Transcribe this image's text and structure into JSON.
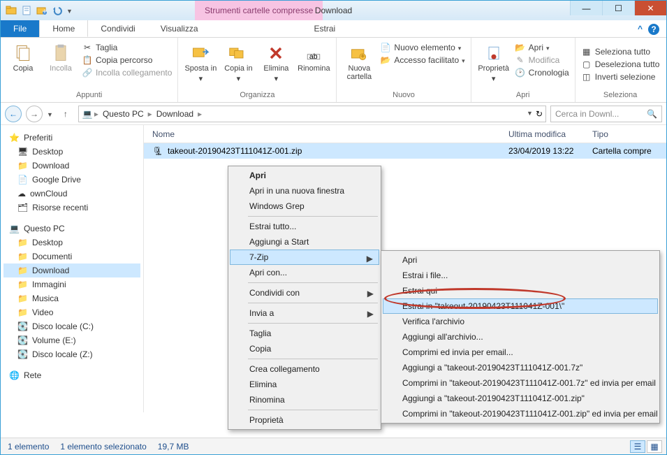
{
  "window": {
    "ctx_tab": "Strumenti cartelle compresse",
    "title": "Download"
  },
  "tabs": {
    "file": "File",
    "home": "Home",
    "condividi": "Condividi",
    "visualizza": "Visualizza",
    "estrai": "Estrai"
  },
  "ribbon": {
    "appunti": {
      "copia": "Copia",
      "incolla": "Incolla",
      "taglia": "Taglia",
      "copia_percorso": "Copia percorso",
      "incolla_collegamento": "Incolla collegamento",
      "label": "Appunti"
    },
    "organizza": {
      "sposta_in": "Sposta in",
      "copia_in": "Copia in",
      "elimina": "Elimina",
      "rinomina": "Rinomina",
      "label": "Organizza"
    },
    "nuovo": {
      "nuova_cartella": "Nuova cartella",
      "nuovo_elemento": "Nuovo elemento",
      "accesso_facilitato": "Accesso facilitato",
      "label": "Nuovo"
    },
    "apri_g": {
      "proprieta": "Proprietà",
      "apri": "Apri",
      "modifica": "Modifica",
      "cronologia": "Cronologia",
      "label": "Apri"
    },
    "seleziona": {
      "tutto": "Seleziona tutto",
      "deseleziona": "Deseleziona tutto",
      "inverti": "Inverti selezione",
      "label": "Seleziona"
    }
  },
  "breadcrumb": {
    "pc": "Questo PC",
    "folder": "Download"
  },
  "search": {
    "placeholder": "Cerca in Downl..."
  },
  "sidebar": {
    "fav": "Preferiti",
    "desktop": "Desktop",
    "download": "Download",
    "gdrive": "Google Drive",
    "owncloud": "ownCloud",
    "recent": "Risorse recenti",
    "pc": "Questo PC",
    "pc_desktop": "Desktop",
    "pc_docs": "Documenti",
    "pc_download": "Download",
    "pc_img": "Immagini",
    "pc_music": "Musica",
    "pc_video": "Video",
    "pc_c": "Disco locale (C:)",
    "pc_e": "Volume (E:)",
    "pc_z": "Disco locale (Z:)",
    "rete": "Rete"
  },
  "columns": {
    "nome": "Nome",
    "data": "Ultima modifica",
    "tipo": "Tipo"
  },
  "file": {
    "name": "takeout-20190423T111041Z-001.zip",
    "date": "23/04/2019 13:22",
    "type": "Cartella compre"
  },
  "ctx1": {
    "apri": "Apri",
    "apri_nf": "Apri in una nuova finestra",
    "wgrep": "Windows Grep",
    "estrai_tutto": "Estrai tutto...",
    "start": "Aggiungi a Start",
    "sevenzip": "7-Zip",
    "apri_con": "Apri con...",
    "condividi": "Condividi con",
    "invia": "Invia a",
    "taglia": "Taglia",
    "copia": "Copia",
    "colleg": "Crea collegamento",
    "elimina": "Elimina",
    "rinomina": "Rinomina",
    "prop": "Proprietà"
  },
  "ctx2": {
    "apri": "Apri",
    "estrai_file": "Estrai i file...",
    "estrai_qui": "Estrai qui",
    "estrai_in": "Estrai in \"takeout-20190423T111041Z-001\\\"",
    "verifica": "Verifica l'archivio",
    "add_arch": "Aggiungi all'archivio...",
    "comp_email": "Comprimi ed invia per email...",
    "add_7z": "Aggiungi a \"takeout-20190423T111041Z-001.7z\"",
    "comp_7z_email": "Comprimi in \"takeout-20190423T111041Z-001.7z\" ed invia per email",
    "add_zip": "Aggiungi a \"takeout-20190423T111041Z-001.zip\"",
    "comp_zip_email": "Comprimi in \"takeout-20190423T111041Z-001.zip\" ed invia per email"
  },
  "status": {
    "count": "1 elemento",
    "sel": "1 elemento selezionato",
    "size": "19,7 MB"
  }
}
